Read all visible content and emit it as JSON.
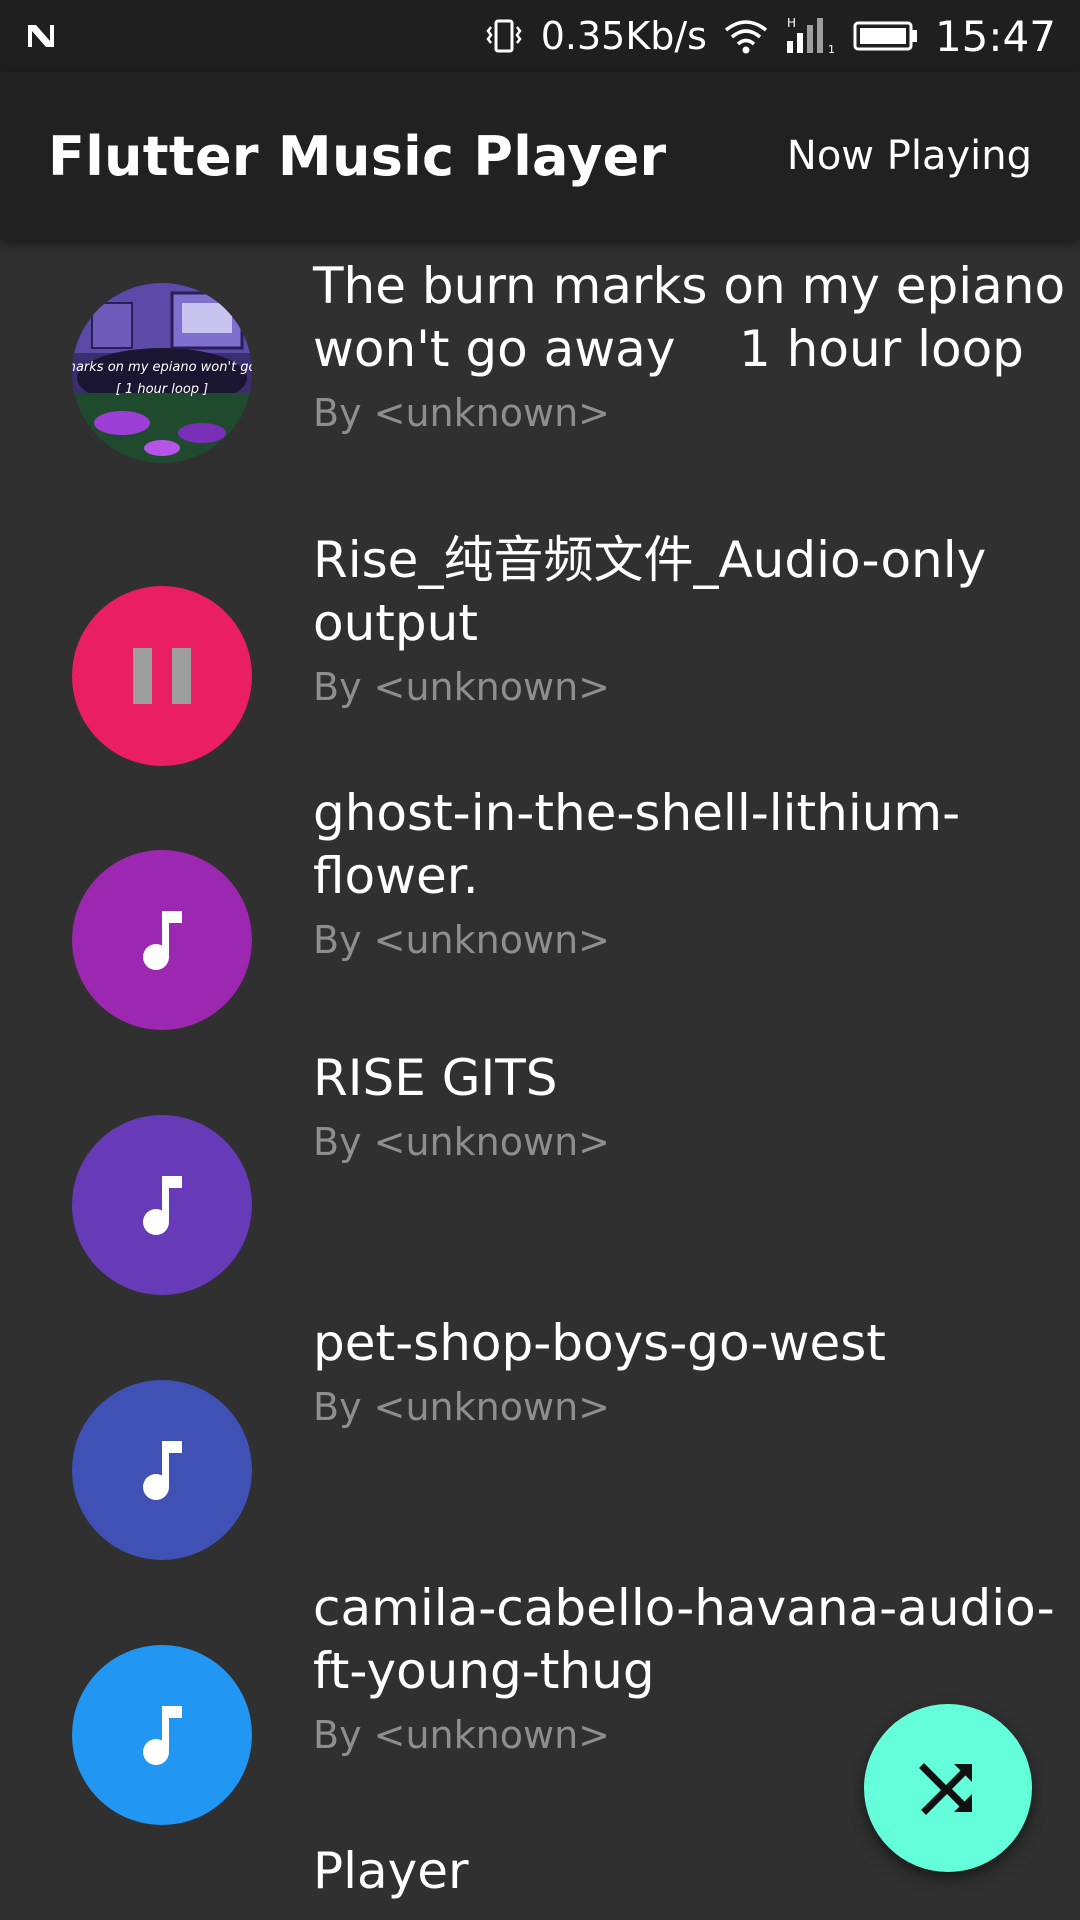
{
  "status_bar": {
    "network_speed": "0.35Kb/s",
    "time": "15:47",
    "icons": [
      "n-logo-icon",
      "vibrate-icon",
      "wifi-icon",
      "signal-icon",
      "battery-icon"
    ]
  },
  "app_bar": {
    "title": "Flutter Music Player",
    "action_label": "Now Playing"
  },
  "songs": [
    {
      "title": "The burn marks on my epiano won't go away    1 hour loop",
      "artist": "By <unknown>",
      "avatar": "album-art",
      "art_text": "burn marks on my epiano won't go away",
      "art_subtext": "[ 1 hour loop ]"
    },
    {
      "title": "Rise_纯音频文件_Audio-only output",
      "artist": "By <unknown>",
      "avatar": "pause-icon",
      "color": "#e91e63"
    },
    {
      "title": "ghost-in-the-shell-lithium-flower.",
      "artist": "By <unknown>",
      "avatar": "music-note-icon",
      "color": "#9c27b0"
    },
    {
      "title": "RISE GITS",
      "artist": "By <unknown>",
      "avatar": "music-note-icon",
      "color": "#673ab7"
    },
    {
      "title": "pet-shop-boys-go-west",
      "artist": "By <unknown>",
      "avatar": "music-note-icon",
      "color": "#3f51b5"
    },
    {
      "title": "camila-cabello-havana-audio-ft-young-thug",
      "artist": "By <unknown>",
      "avatar": "music-note-icon",
      "color": "#2196f3"
    },
    {
      "title": "Player",
      "artist": "",
      "avatar": "none"
    }
  ],
  "fab": {
    "icon": "shuffle-icon",
    "color": "#64ffda"
  },
  "theme": {
    "background": "#303030",
    "app_bar": "#212121",
    "status_bar": "#1f1f1f",
    "secondary_text": "#8e8e8e"
  }
}
